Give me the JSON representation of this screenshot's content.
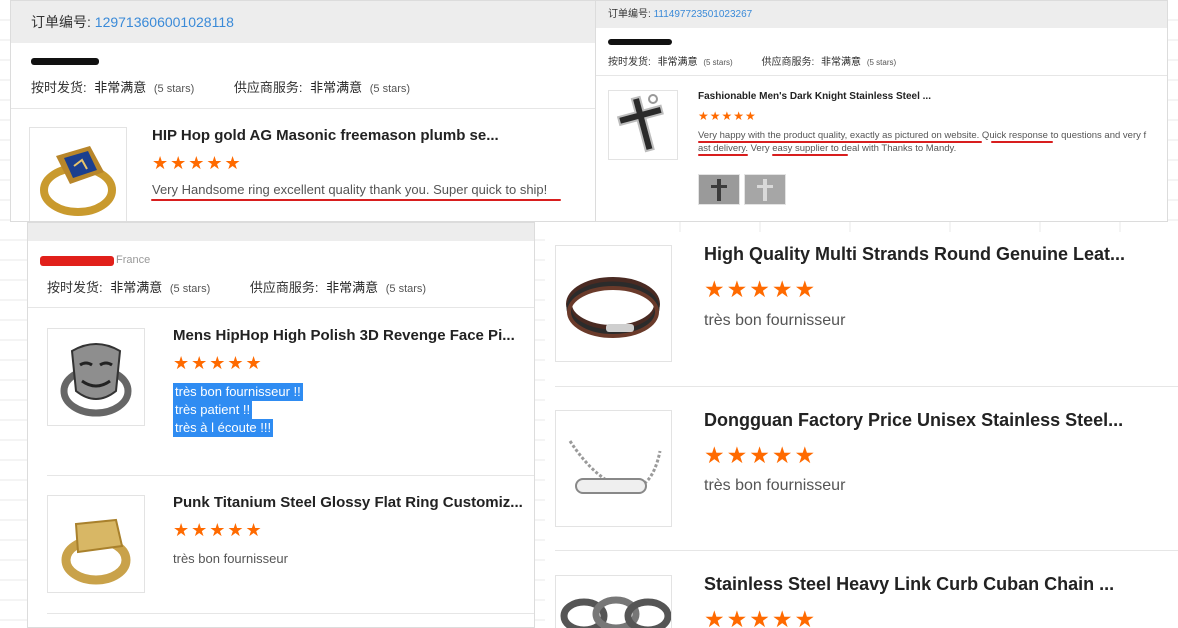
{
  "order1": {
    "label": "订单编号:",
    "number": "129713606001028118",
    "on_time_label": "按时发货:",
    "on_time_value": "非常满意",
    "on_time_stars": "(5 stars)",
    "supplier_label": "供应商服务:",
    "supplier_value": "非常满意",
    "supplier_stars": "(5 stars)",
    "product": {
      "title": "HIP Hop gold AG Masonic freemason plumb se...",
      "stars": "★★★★★",
      "review": "Very Handsome ring excellent quality thank you.  Super quick to ship!"
    }
  },
  "order2": {
    "label": "订单编号:",
    "number": "111497723501023267",
    "on_time_label": "按时发货:",
    "on_time_value": "非常满意",
    "on_time_stars": "(5 stars)",
    "supplier_label": "供应商服务:",
    "supplier_value": "非常满意",
    "supplier_stars": "(5 stars)",
    "product": {
      "title": "Fashionable Men's Dark Knight Stainless Steel ...",
      "stars": "★★★★★",
      "review_line1": "Very happy with the product quality, exactly as pictured on website.  Quick response to questions and very f",
      "review_line2": "ast delivery. Very easy supplier to deal with Thanks to Mandy."
    }
  },
  "order3": {
    "country": "France",
    "on_time_label": "按时发货:",
    "on_time_value": "非常满意",
    "on_time_stars": "(5 stars)",
    "supplier_label": "供应商服务:",
    "supplier_value": "非常满意",
    "supplier_stars": "(5 stars)",
    "products": [
      {
        "title": "Mens HipHop High Polish 3D Revenge Face Pi...",
        "stars": "★★★★★",
        "review_lines": [
          "très bon fournisseur !!",
          "très patient !!",
          "très à l écoute !!!"
        ]
      },
      {
        "title": "Punk Titanium Steel Glossy Flat Ring Customiz...",
        "stars": "★★★★★",
        "review": "très bon fournisseur"
      }
    ]
  },
  "right_list": [
    {
      "title": "High Quality Multi Strands Round Genuine Leat...",
      "stars": "★★★★★",
      "review": "très bon fournisseur"
    },
    {
      "title": "Dongguan Factory Price Unisex Stainless Steel...",
      "stars": "★★★★★",
      "review": "très bon fournisseur"
    },
    {
      "title": "Stainless Steel Heavy Link Curb Cuban Chain ...",
      "stars": "★★★★★"
    }
  ],
  "colors": {
    "accent_orange": "#ff6a00",
    "link_blue": "#3a8ad8",
    "highlight_blue": "#2f8cf2",
    "annotation_red": "#d81e1e"
  }
}
